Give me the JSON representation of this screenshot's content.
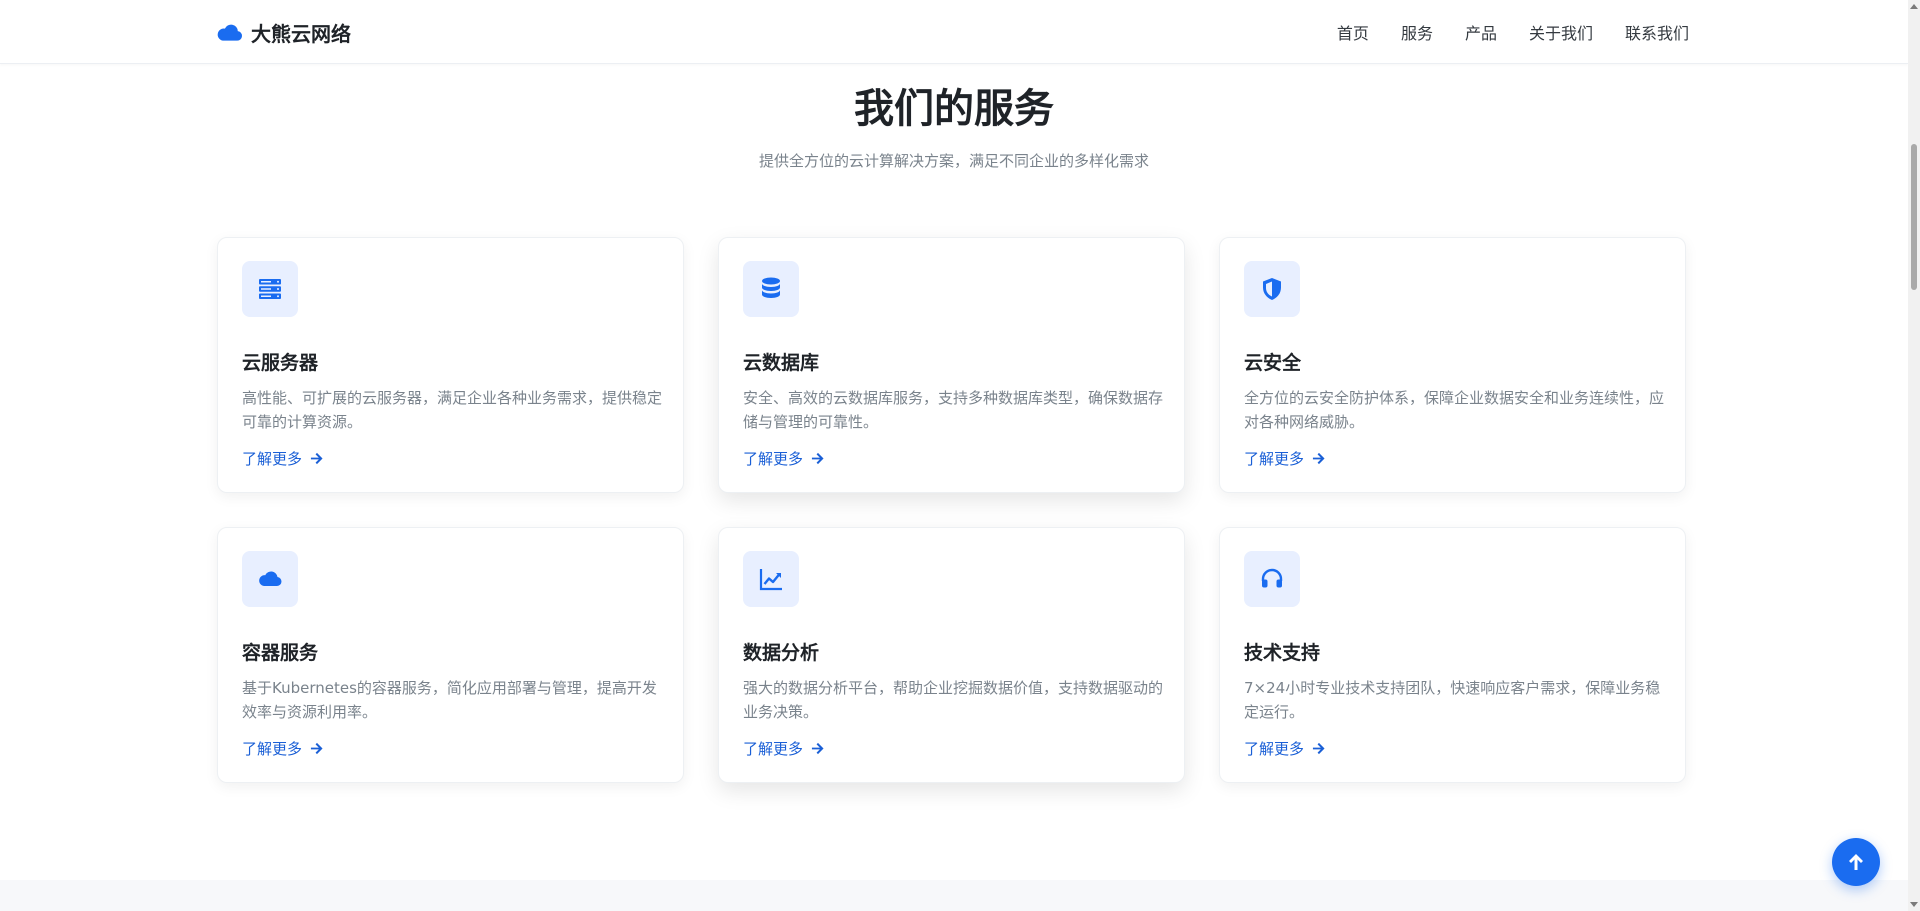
{
  "brand": {
    "name": "大熊云网络",
    "icon": "cloud-icon",
    "color": "#1a6cf0"
  },
  "nav": {
    "items": [
      {
        "label": "首页"
      },
      {
        "label": "服务"
      },
      {
        "label": "产品"
      },
      {
        "label": "关于我们"
      },
      {
        "label": "联系我们"
      }
    ]
  },
  "section": {
    "title": "我们的服务",
    "subtitle": "提供全方位的云计算解决方案，满足不同企业的多样化需求"
  },
  "services": [
    {
      "icon": "server-icon",
      "title": "云服务器",
      "desc": "高性能、可扩展的云服务器，满足企业各种业务需求，提供稳定可靠的计算资源。",
      "link": "了解更多"
    },
    {
      "icon": "database-icon",
      "title": "云数据库",
      "desc": "安全、高效的云数据库服务，支持多种数据库类型，确保数据存储与管理的可靠性。",
      "link": "了解更多"
    },
    {
      "icon": "shield-icon",
      "title": "云安全",
      "desc": "全方位的云安全防护体系，保障企业数据安全和业务连续性，应对各种网络威胁。",
      "link": "了解更多"
    },
    {
      "icon": "cloud-icon",
      "title": "容器服务",
      "desc": "基于Kubernetes的容器服务，简化应用部署与管理，提高开发效率与资源利用率。",
      "link": "了解更多"
    },
    {
      "icon": "chart-line-icon",
      "title": "数据分析",
      "desc": "强大的数据分析平台，帮助企业挖掘数据价值，支持数据驱动的业务决策。",
      "link": "了解更多"
    },
    {
      "icon": "headset-icon",
      "title": "技术支持",
      "desc": "7×24小时专业技术支持团队，快速响应客户需求，保障业务稳定运行。",
      "link": "了解更多"
    }
  ],
  "colors": {
    "accent": "#1a6cf0",
    "link": "#1a5fd6",
    "icon_bg": "#e8efff"
  },
  "back_to_top": {
    "icon": "arrow-up-icon"
  }
}
